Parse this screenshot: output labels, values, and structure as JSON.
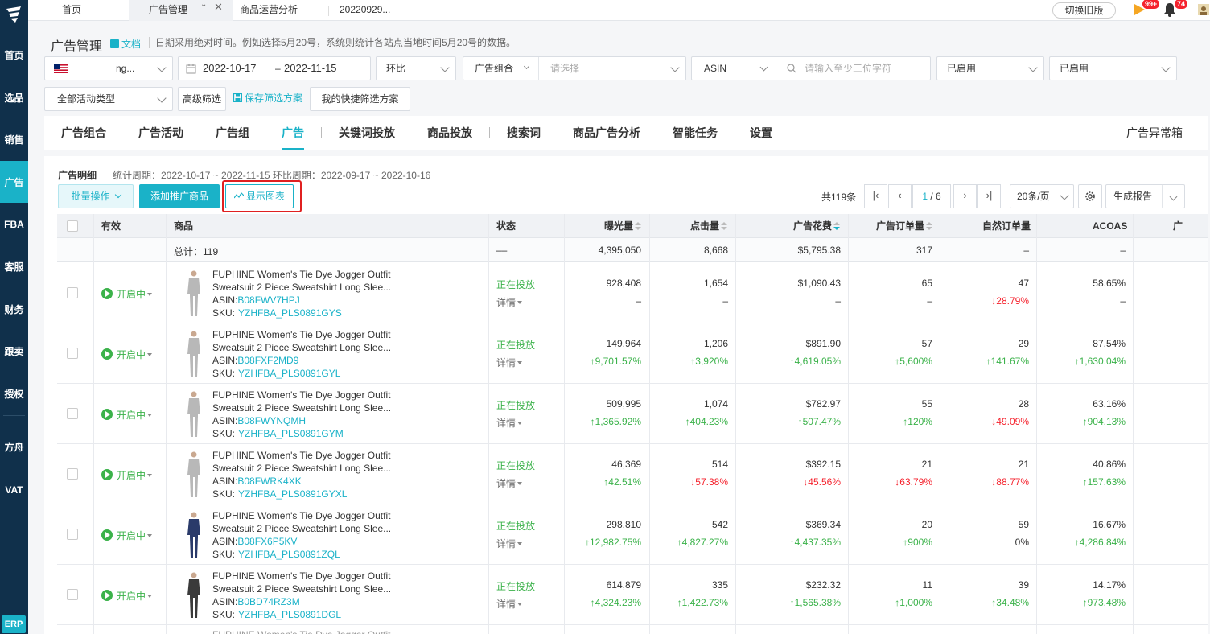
{
  "top_tabs": {
    "home": "首页",
    "ads": "广告管理",
    "ops": "商品运营分析",
    "date": "20220929..."
  },
  "top_right": {
    "old_version": "切换旧版",
    "flag_badge": "99+",
    "bell_badge": "74"
  },
  "sidebar": {
    "items": [
      "首页",
      "选品",
      "销售",
      "广告",
      "FBA",
      "客服",
      "财务",
      "跟卖",
      "授权",
      "方舟",
      "VAT"
    ],
    "erp": "ERP"
  },
  "page": {
    "title": "广告管理",
    "doc_link": "文档",
    "hint": "日期采用绝对时间。例如选择5月20号，系统则统计各站点当地时间5月20号的数据。"
  },
  "filters": {
    "store": "ng...",
    "date_start": "2022-10-17",
    "date_sep": "–",
    "date_end": "2022-11-15",
    "compare": "环比",
    "group_label": "广告组合",
    "group_placeholder": "请选择",
    "asin_label": "ASIN",
    "asin_placeholder": "请输入至少三位字符",
    "status1": "已启用",
    "status2": "已启用",
    "activity_type": "全部活动类型",
    "advanced": "高级筛选",
    "save_scheme": "保存筛选方案",
    "my_schemes": "我的快捷筛选方案"
  },
  "tabs": [
    "广告组合",
    "广告活动",
    "广告组",
    "广告",
    "关键词投放",
    "商品投放",
    "搜索词",
    "商品广告分析",
    "智能任务",
    "设置"
  ],
  "tabs_right": "广告异常箱",
  "panel": {
    "title": "广告明细",
    "period": "统计周期：2022-10-17 ~ 2022-11-15 环比周期：2022-09-17 ~ 2022-10-16",
    "batch": "批量操作",
    "add_product": "添加推广商品",
    "show_chart": "显示图表",
    "total": "共119条",
    "page_current": "1",
    "page_total": "/ 6",
    "page_size": "20条/页",
    "report": "生成报告"
  },
  "table": {
    "headers": {
      "effective": "有效",
      "product": "商品",
      "status": "状态",
      "impressions": "曝光量",
      "clicks": "点击量",
      "spend": "广告花费",
      "orders": "广告订单量",
      "organic": "自然订单量",
      "acoas": "ACOAS",
      "extra": "广"
    },
    "totals": {
      "label": "总计：119",
      "status": "––",
      "impressions": "4,395,050",
      "clicks": "8,668",
      "spend": "$5,795.38",
      "orders": "317",
      "organic": "–",
      "acoas": "–"
    },
    "running_label": "开启中",
    "status_label": "正在投放",
    "detail_label": "详情",
    "asin_prefix": "ASIN:",
    "sku_prefix": "SKU:",
    "title_line1": "FUPHINE Women's Tie Dye Jogger Outfit",
    "title_line2": "Sweatsuit 2 Piece Sweatshirt Long Slee...",
    "rows": [
      {
        "asin": "B08FWV7HPJ",
        "sku": "YZHFBA_PLS0891GYS",
        "color": "#b8b8b8",
        "imp": "928,408",
        "imp_c": "–",
        "imp_d": "",
        "clk": "1,654",
        "clk_c": "–",
        "clk_d": "",
        "spd": "$1,090.43",
        "spd_c": "–",
        "spd_d": "",
        "ord": "65",
        "ord_c": "–",
        "ord_d": "",
        "org": "47",
        "org_c": "↓28.79%",
        "org_d": "down",
        "aco": "58.65%",
        "aco_c": "–",
        "aco_d": ""
      },
      {
        "asin": "B08FXF2MD9",
        "sku": "YZHFBA_PLS0891GYL",
        "color": "#b8b8b8",
        "imp": "149,964",
        "imp_c": "↑9,701.57%",
        "imp_d": "up",
        "clk": "1,206",
        "clk_c": "↑3,920%",
        "clk_d": "up",
        "spd": "$891.90",
        "spd_c": "↑4,619.05%",
        "spd_d": "up",
        "ord": "57",
        "ord_c": "↑5,600%",
        "ord_d": "up",
        "org": "29",
        "org_c": "↑141.67%",
        "org_d": "up",
        "aco": "87.54%",
        "aco_c": "↑1,630.04%",
        "aco_d": "up"
      },
      {
        "asin": "B08FWYNQMH",
        "sku": "YZHFBA_PLS0891GYM",
        "color": "#b8b8b8",
        "imp": "509,995",
        "imp_c": "↑1,365.92%",
        "imp_d": "up",
        "clk": "1,074",
        "clk_c": "↑404.23%",
        "clk_d": "up",
        "spd": "$782.97",
        "spd_c": "↑507.47%",
        "spd_d": "up",
        "ord": "55",
        "ord_c": "↑120%",
        "ord_d": "up",
        "org": "28",
        "org_c": "↓49.09%",
        "org_d": "down",
        "aco": "63.16%",
        "aco_c": "↑904.13%",
        "aco_d": "up"
      },
      {
        "asin": "B08FWRK4XK",
        "sku": "YZHFBA_PLS0891GYXL",
        "color": "#b8b8b8",
        "imp": "46,369",
        "imp_c": "↑42.51%",
        "imp_d": "up",
        "clk": "514",
        "clk_c": "↓57.38%",
        "clk_d": "down",
        "spd": "$392.15",
        "spd_c": "↓45.56%",
        "spd_d": "down",
        "ord": "21",
        "ord_c": "↓63.79%",
        "ord_d": "down",
        "org": "21",
        "org_c": "↓88.77%",
        "org_d": "down",
        "aco": "40.86%",
        "aco_c": "↑157.63%",
        "aco_d": "up"
      },
      {
        "asin": "B08FX6P5KV",
        "sku": "YZHFBA_PLS0891ZQL",
        "color": "#2a3a6a",
        "imp": "298,810",
        "imp_c": "↑12,982.75%",
        "imp_d": "up",
        "clk": "542",
        "clk_c": "↑4,827.27%",
        "clk_d": "up",
        "spd": "$369.34",
        "spd_c": "↑4,437.35%",
        "spd_d": "up",
        "ord": "20",
        "ord_c": "↑900%",
        "ord_d": "up",
        "org": "59",
        "org_c": "0%",
        "org_d": "",
        "aco": "16.67%",
        "aco_c": "↑4,286.84%",
        "aco_d": "up"
      },
      {
        "asin": "B0BD74RZ3M",
        "sku": "YZHFBA_PLS0891DGL",
        "color": "#3a3a3a",
        "imp": "614,879",
        "imp_c": "↑4,324.23%",
        "imp_d": "up",
        "clk": "335",
        "clk_c": "↑1,422.73%",
        "clk_d": "up",
        "spd": "$232.32",
        "spd_c": "↑1,565.38%",
        "spd_d": "up",
        "ord": "11",
        "ord_c": "↑1,000%",
        "ord_d": "up",
        "org": "39",
        "org_c": "↑34.48%",
        "org_d": "up",
        "aco": "14.17%",
        "aco_c": "↑973.48%",
        "aco_d": "up"
      }
    ]
  }
}
